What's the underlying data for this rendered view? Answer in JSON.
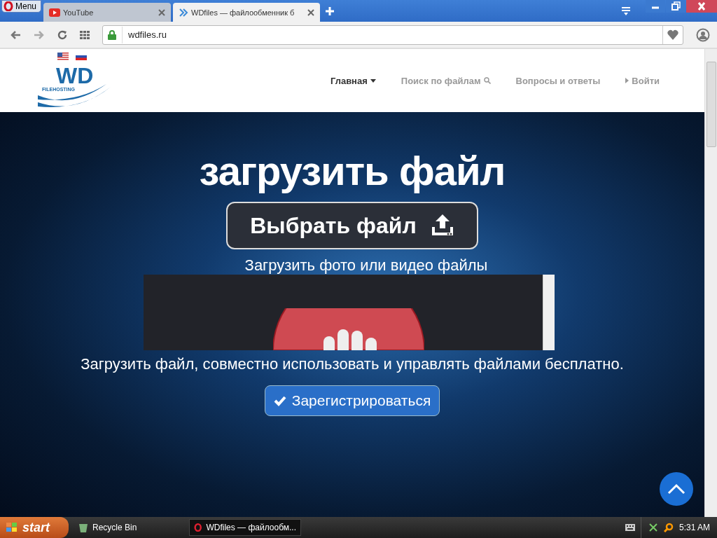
{
  "browser": {
    "menu_label": "Menu",
    "tabs": [
      {
        "title": "YouTube",
        "selected": false,
        "kind": "youtube"
      },
      {
        "title": "WDfiles — файлообменник б",
        "selected": true,
        "kind": "wdfiles"
      }
    ],
    "address": "wdfiles.ru"
  },
  "header": {
    "logo_text": "WD",
    "logo_subtext": "FILEHOSTING",
    "nav": [
      {
        "label": "Главная",
        "selected": true,
        "kind": "dropdown"
      },
      {
        "label": "Поиск по файлам",
        "selected": false,
        "kind": "search"
      },
      {
        "label": "Вопросы и ответы",
        "selected": false,
        "kind": "plain"
      },
      {
        "label": "Войти",
        "selected": false,
        "kind": "login"
      }
    ]
  },
  "hero": {
    "title": "загрузить файл",
    "choose_button": "Выбрать файл",
    "subtitle": "Загрузить фото или видео файлы",
    "tagline": "Загрузить файл, совместно использовать и управлять файлами бесплатно.",
    "register_button": "Зарегистрироваться"
  },
  "taskbar": {
    "start": "start",
    "items": [
      {
        "label": "Recycle Bin",
        "selected": false,
        "kind": "bin"
      },
      {
        "label": "WDfiles — файлообм...",
        "selected": true,
        "kind": "opera"
      }
    ],
    "clock": "5:31 AM"
  }
}
